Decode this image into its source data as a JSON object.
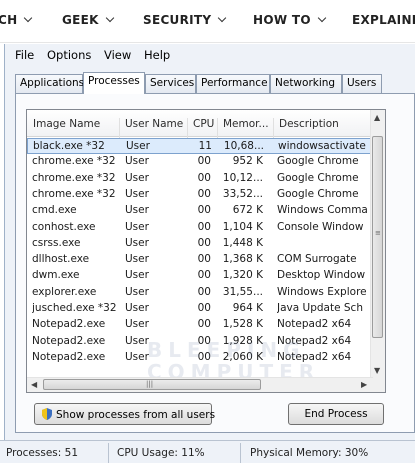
{
  "topnav": [
    {
      "label": "CH"
    },
    {
      "label": "GEEK"
    },
    {
      "label": "SECURITY"
    },
    {
      "label": "HOW TO"
    },
    {
      "label": "EXPLAINI"
    }
  ],
  "menu": {
    "file": "File",
    "options": "Options",
    "view": "View",
    "help": "Help"
  },
  "tabs": [
    "Applications",
    "Processes",
    "Services",
    "Performance",
    "Networking",
    "Users"
  ],
  "active_tab": "Processes",
  "columns": [
    "Image Name",
    "User Name",
    "CPU",
    "Memor...",
    "Description"
  ],
  "rows": [
    {
      "name": "black.exe *32",
      "user": "User",
      "cpu": "11",
      "mem": "10,68...",
      "desc": "windowsactivate",
      "selected": true
    },
    {
      "name": "chrome.exe *32",
      "user": "User",
      "cpu": "00",
      "mem": "952 K",
      "desc": "Google Chrome"
    },
    {
      "name": "chrome.exe *32",
      "user": "User",
      "cpu": "00",
      "mem": "10,12...",
      "desc": "Google Chrome"
    },
    {
      "name": "chrome.exe *32",
      "user": "User",
      "cpu": "00",
      "mem": "33,52...",
      "desc": "Google Chrome"
    },
    {
      "name": "cmd.exe",
      "user": "User",
      "cpu": "00",
      "mem": "672 K",
      "desc": "Windows Comma"
    },
    {
      "name": "conhost.exe",
      "user": "User",
      "cpu": "00",
      "mem": "1,104 K",
      "desc": "Console Window"
    },
    {
      "name": "csrss.exe",
      "user": "User",
      "cpu": "00",
      "mem": "1,448 K",
      "desc": ""
    },
    {
      "name": "dllhost.exe",
      "user": "User",
      "cpu": "00",
      "mem": "1,368 K",
      "desc": "COM Surrogate"
    },
    {
      "name": "dwm.exe",
      "user": "User",
      "cpu": "00",
      "mem": "1,320 K",
      "desc": "Desktop Window"
    },
    {
      "name": "explorer.exe",
      "user": "User",
      "cpu": "00",
      "mem": "31,55...",
      "desc": "Windows Explore"
    },
    {
      "name": "jusched.exe *32",
      "user": "User",
      "cpu": "00",
      "mem": "964 K",
      "desc": "Java Update Sch"
    },
    {
      "name": "Notepad2.exe",
      "user": "User",
      "cpu": "00",
      "mem": "1,528 K",
      "desc": "Notepad2 x64"
    },
    {
      "name": "Notepad2.exe",
      "user": "User",
      "cpu": "00",
      "mem": "1,928 K",
      "desc": "Notepad2 x64"
    },
    {
      "name": "Notepad2.exe",
      "user": "User",
      "cpu": "00",
      "mem": "2,060 K",
      "desc": "Notepad2 x64"
    }
  ],
  "watermark": [
    "BLEEPING",
    "COMPUTER"
  ],
  "buttons": {
    "show_all": "Show processes from all users",
    "end_process": "End Process"
  },
  "status": {
    "processes": "Processes: 51",
    "cpu": "CPU Usage: 11%",
    "memory": "Physical Memory: 30%"
  },
  "colors": {
    "selection": "#dcebfc",
    "window_bg": "#eef2f8"
  }
}
